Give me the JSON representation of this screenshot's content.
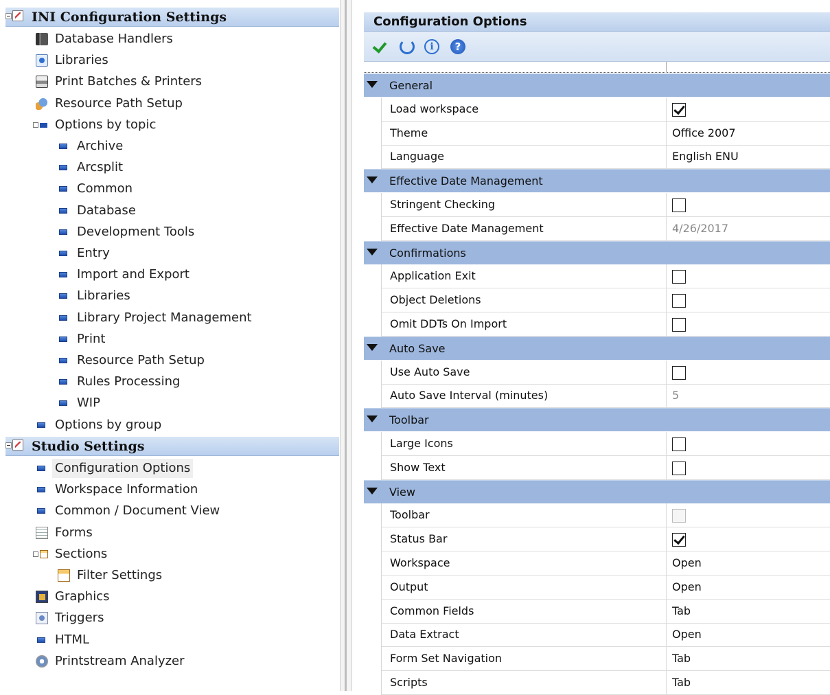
{
  "tree": {
    "ini_header": "INI Configuration Settings",
    "ini_items": [
      {
        "label": "Database Handlers",
        "icon": "database-icon"
      },
      {
        "label": "Libraries",
        "icon": "library-icon"
      },
      {
        "label": "Print Batches & Printers",
        "icon": "printer-icon"
      },
      {
        "label": "Resource Path Setup",
        "icon": "resource-path-icon"
      },
      {
        "label": "Options by topic",
        "icon": "folder-expanded-icon"
      }
    ],
    "topics": [
      "Archive",
      "Arcsplit",
      "Common",
      "Database",
      "Development Tools",
      "Entry",
      "Import and Export",
      "Libraries",
      "Library Project Management",
      "Print",
      "Resource Path Setup",
      "Rules Processing",
      "WIP"
    ],
    "options_by_group": "Options by group",
    "studio_header": "Studio Settings",
    "studio_items": [
      {
        "label": "Configuration Options",
        "icon": "option-icon",
        "selected": true
      },
      {
        "label": "Workspace Information",
        "icon": "option-icon"
      },
      {
        "label": "Common / Document View",
        "icon": "option-icon"
      },
      {
        "label": "Forms",
        "icon": "forms-icon"
      },
      {
        "label": "Sections",
        "icon": "sections-icon"
      },
      {
        "label": "Filter Settings",
        "icon": "filter-icon"
      },
      {
        "label": "Graphics",
        "icon": "graphics-icon"
      },
      {
        "label": "Triggers",
        "icon": "triggers-icon"
      },
      {
        "label": "HTML",
        "icon": "option-icon"
      },
      {
        "label": "Printstream Analyzer",
        "icon": "analyzer-icon"
      }
    ]
  },
  "panel": {
    "title": "Configuration Options",
    "toolbar": {
      "apply": "checkmark-icon",
      "refresh": "refresh-icon",
      "info": "info-icon",
      "help": "help-icon"
    },
    "categories": [
      {
        "name": "General",
        "props": [
          {
            "name": "Load workspace",
            "type": "checkbox",
            "checked": true
          },
          {
            "name": "Theme",
            "type": "text",
            "value": "Office 2007"
          },
          {
            "name": "Language",
            "type": "text",
            "value": "English ENU"
          }
        ]
      },
      {
        "name": "Effective Date Management",
        "props": [
          {
            "name": "Stringent Checking",
            "type": "checkbox",
            "checked": false
          },
          {
            "name": "Effective Date Management",
            "type": "text",
            "value": "4/26/2017",
            "readonly": true
          }
        ]
      },
      {
        "name": "Confirmations",
        "props": [
          {
            "name": "Application Exit",
            "type": "checkbox",
            "checked": false
          },
          {
            "name": "Object Deletions",
            "type": "checkbox",
            "checked": false
          },
          {
            "name": "Omit DDTs On Import",
            "type": "checkbox",
            "checked": false
          }
        ]
      },
      {
        "name": "Auto Save",
        "props": [
          {
            "name": "Use Auto Save",
            "type": "checkbox",
            "checked": false
          },
          {
            "name": "Auto Save Interval (minutes)",
            "type": "text",
            "value": "5",
            "readonly": true
          }
        ]
      },
      {
        "name": "Toolbar",
        "props": [
          {
            "name": "Large Icons",
            "type": "checkbox",
            "checked": false
          },
          {
            "name": "Show Text",
            "type": "checkbox",
            "checked": false
          }
        ]
      },
      {
        "name": "View",
        "props": [
          {
            "name": "Toolbar",
            "type": "checkbox",
            "checked": false,
            "disabled": true
          },
          {
            "name": "Status Bar",
            "type": "checkbox",
            "checked": true
          },
          {
            "name": "Workspace",
            "type": "text",
            "value": "Open"
          },
          {
            "name": "Output",
            "type": "text",
            "value": "Open"
          },
          {
            "name": "Common Fields",
            "type": "text",
            "value": "Tab"
          },
          {
            "name": "Data Extract",
            "type": "text",
            "value": "Open"
          },
          {
            "name": "Form Set Navigation",
            "type": "text",
            "value": "Tab"
          },
          {
            "name": "Scripts",
            "type": "text",
            "value": "Tab"
          }
        ]
      }
    ]
  }
}
